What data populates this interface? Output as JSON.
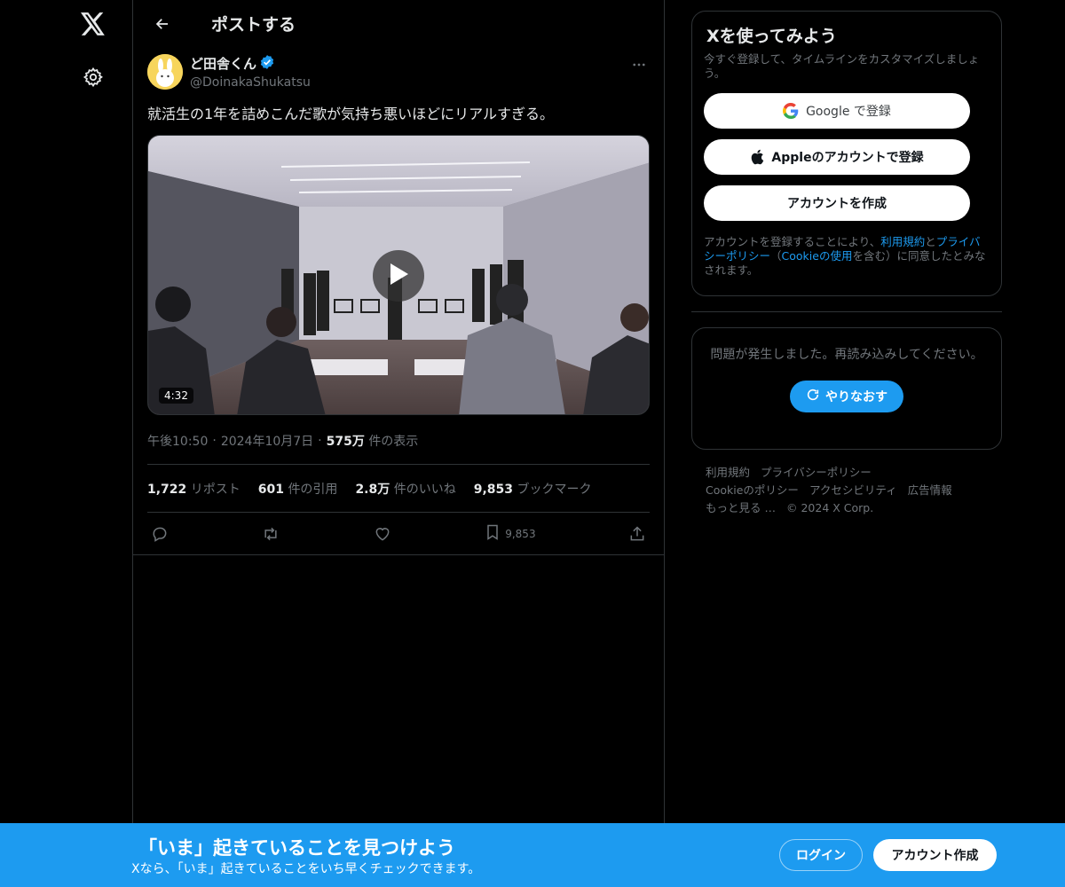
{
  "header": {
    "title": "ポストする"
  },
  "post": {
    "display_name": "ど田舎くん",
    "handle": "@DoinakaShukatsu",
    "text": "就活生の1年を詰めこんだ歌が気持ち悪いほどにリアルすぎる。",
    "video_duration": "4:32",
    "time": "午後10:50",
    "date": "2024年10月7日",
    "views_count": "575万",
    "views_label": "件の表示",
    "separator": "·",
    "stats": {
      "reposts_count": "1,722",
      "reposts_label": "リポスト",
      "quotes_count": "601",
      "quotes_label": "件の引用",
      "likes_count": "2.8万",
      "likes_label": "件のいいね",
      "bookmarks_count": "9,853",
      "bookmarks_label": "ブックマーク"
    },
    "actions": {
      "bookmark_count": "9,853"
    }
  },
  "sidebar": {
    "signup": {
      "title": "Xを使ってみよう",
      "subtitle": "今すぐ登録して、タイムラインをカスタマイズしましょう。",
      "google_label": "Google で登録",
      "apple_label": "Appleのアカウントで登録",
      "create_label": "アカウントを作成",
      "terms_pre": "アカウントを登録することにより、",
      "terms_link": "利用規約",
      "terms_and": "と",
      "privacy_link": "プライバシーポリシー",
      "cookie_open": "（",
      "cookie_link": "Cookieの使用",
      "terms_post": "を含む）に同意したとみなされます。"
    },
    "error": {
      "message": "問題が発生しました。再読み込みしてください。",
      "retry_label": "やりなおす"
    },
    "footer": {
      "links": [
        "利用規約",
        "プライバシーポリシー",
        "Cookieのポリシー",
        "アクセシビリティ",
        "広告情報",
        "もっと見る …"
      ],
      "copyright": "© 2024 X Corp."
    }
  },
  "banner": {
    "title": "「いま」起きていることを見つけよう",
    "subtitle": "Xなら、「いま」起きていることをいち早くチェックできます。",
    "login_label": "ログイン",
    "signup_label": "アカウント作成"
  },
  "colors": {
    "accent": "#1d9bf0",
    "background": "#000000",
    "border": "#2f3336",
    "muted": "#71767b",
    "text": "#e7e9ea"
  },
  "icons": [
    "x-logo-icon",
    "gear-icon",
    "back-arrow-icon",
    "verified-badge-icon",
    "more-icon",
    "play-icon",
    "reply-icon",
    "repost-icon",
    "like-icon",
    "bookmark-icon",
    "share-icon",
    "google-icon",
    "apple-icon",
    "refresh-icon"
  ]
}
